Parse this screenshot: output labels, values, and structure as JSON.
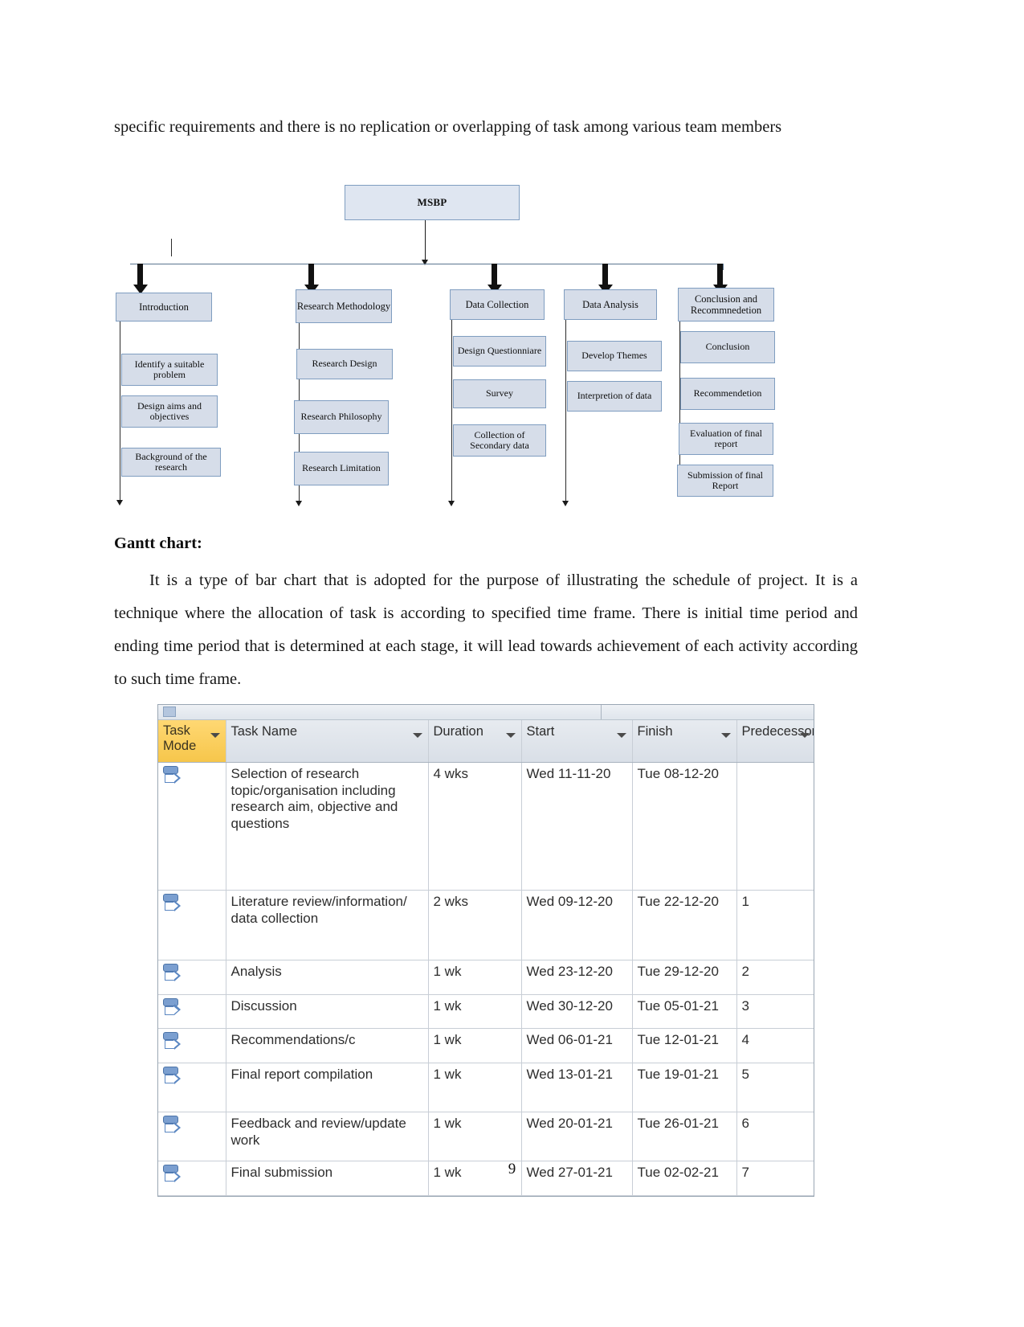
{
  "document": {
    "paragraph_1": "specific requirements and there is no replication or overlapping of task among various team members",
    "gantt_heading": "Gantt chart:",
    "paragraph_2_first": "It is a type of bar chart that is adopted for the purpose of illustrating the schedule of project. It is a technique where the allocation of task is according to specified time frame. There is initial time period and ending time period that is determined at each stage, it will lead towards achievement of each activity according to such time frame.",
    "page_number": "9"
  },
  "diagram": {
    "root": "MSBP",
    "branches": [
      {
        "title": "Introduction",
        "children": [
          "Identify a suitable problem",
          "Design aims and objectives",
          "Background of the research"
        ]
      },
      {
        "title": "Research Methodology",
        "children": [
          "Research Design",
          "Research Philosophy",
          "Research Limitation"
        ]
      },
      {
        "title": "Data Collection",
        "children": [
          "Design Questionniare",
          "Survey",
          "Collection of Secondary data"
        ]
      },
      {
        "title": "Data Analysis",
        "children": [
          "Develop Themes",
          "Interpretion of data"
        ]
      },
      {
        "title": "Conclusion and Recommnedetion",
        "children": [
          "Conclusion",
          "Recommendetion",
          "Evaluation of final report",
          "Submission of final Report"
        ]
      }
    ],
    "colors": {
      "node_fill": "#d6dde9",
      "node_border": "#7f9dc0",
      "connector": "#59748f"
    }
  },
  "gantt_table": {
    "columns": [
      "Task Mode",
      "Task Name",
      "Duration",
      "Start",
      "Finish",
      "Predecessors"
    ],
    "rows": [
      {
        "mode_icon": "auto-scheduled-icon",
        "name": "Selection of research topic/organisation including research aim, objective and questions",
        "duration": "4 wks",
        "start": "Wed 11-11-20",
        "finish": "Tue 08-12-20",
        "predecessors": ""
      },
      {
        "mode_icon": "auto-scheduled-icon",
        "name": "Literature review/information/ data collection",
        "duration": "2 wks",
        "start": "Wed 09-12-20",
        "finish": "Tue 22-12-20",
        "predecessors": "1"
      },
      {
        "mode_icon": "auto-scheduled-icon",
        "name": "Analysis",
        "duration": "1 wk",
        "start": "Wed 23-12-20",
        "finish": "Tue 29-12-20",
        "predecessors": "2"
      },
      {
        "mode_icon": "auto-scheduled-icon",
        "name": "Discussion",
        "duration": "1 wk",
        "start": "Wed 30-12-20",
        "finish": "Tue 05-01-21",
        "predecessors": "3"
      },
      {
        "mode_icon": "auto-scheduled-icon",
        "name": "Recommendations/c",
        "duration": "1 wk",
        "start": "Wed 06-01-21",
        "finish": "Tue 12-01-21",
        "predecessors": "4"
      },
      {
        "mode_icon": "auto-scheduled-icon",
        "name": "Final report compilation",
        "duration": "1 wk",
        "start": "Wed 13-01-21",
        "finish": "Tue 19-01-21",
        "predecessors": "5"
      },
      {
        "mode_icon": "auto-scheduled-icon",
        "name": "Feedback and review/update work",
        "duration": "1 wk",
        "start": "Wed 20-01-21",
        "finish": "Tue 26-01-21",
        "predecessors": "6"
      },
      {
        "mode_icon": "auto-scheduled-icon",
        "name": "Final submission",
        "duration": "1 wk",
        "start": "Wed 27-01-21",
        "finish": "Tue 02-02-21",
        "predecessors": "7"
      }
    ],
    "colors": {
      "header_fill": "#dfe5ec",
      "taskmode_fill": "#f6c64b",
      "grid": "#c8ced6",
      "icon": "#5b87c2"
    }
  }
}
